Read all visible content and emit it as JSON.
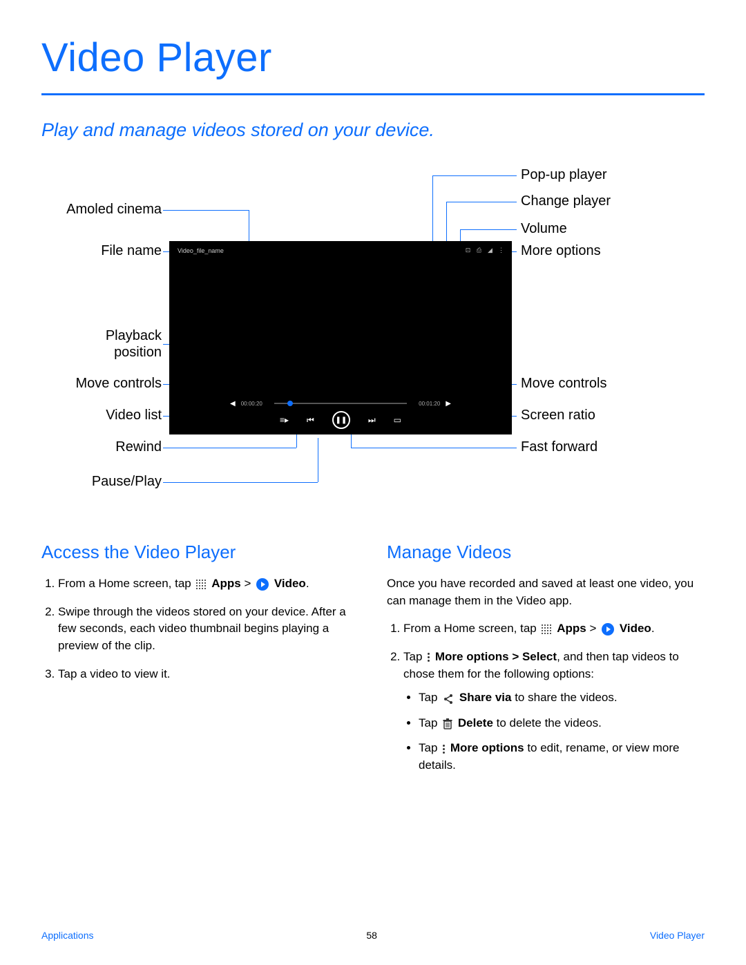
{
  "title": "Video Player",
  "subtitle": "Play and manage videos stored on your device.",
  "diagram": {
    "labels": {
      "amoled_cinema": "Amoled cinema",
      "file_name": "File name",
      "playback_position": "Playback\nposition",
      "move_controls_left": "Move controls",
      "video_list": "Video list",
      "rewind": "Rewind",
      "pause_play": "Pause/Play",
      "popup_player": "Pop-up player",
      "change_player": "Change player",
      "volume": "Volume",
      "more_options": "More options",
      "move_controls_right": "Move controls",
      "screen_ratio": "Screen ratio",
      "fast_forward": "Fast forward"
    },
    "player": {
      "filename": "Video_file_name",
      "time_current": "00:00:20",
      "time_total": "00:01:20"
    }
  },
  "sections": {
    "access": {
      "heading": "Access the Video Player",
      "step1_pre": "From a Home screen, tap ",
      "step1_apps": "Apps",
      "step1_gt": " > ",
      "step1_video": "Video",
      "step1_end": ".",
      "step2": "Swipe through the videos stored on your device. After a few seconds, each video thumbnail begins playing a preview of the clip.",
      "step3": "Tap a video to view it."
    },
    "manage": {
      "heading": "Manage Videos",
      "intro": "Once you have recorded and saved at least one video, you can manage them in the Video app.",
      "step1_pre": "From a Home screen, tap ",
      "step1_apps": "Apps",
      "step1_gt": " > ",
      "step1_video": "Video",
      "step1_end": ".",
      "step2_pre": "Tap ",
      "step2_more": "More options > Select",
      "step2_post": ", and then tap videos to chose them for the following options:",
      "bullet1_pre": "Tap ",
      "bullet1_b": "Share via",
      "bullet1_post": " to share the videos.",
      "bullet2_pre": "Tap ",
      "bullet2_b": "Delete",
      "bullet2_post": " to delete the videos.",
      "bullet3_pre": "Tap ",
      "bullet3_b": "More options",
      "bullet3_post": " to edit, rename, or view more details."
    }
  },
  "footer": {
    "left": "Applications",
    "center": "58",
    "right": "Video Player"
  }
}
